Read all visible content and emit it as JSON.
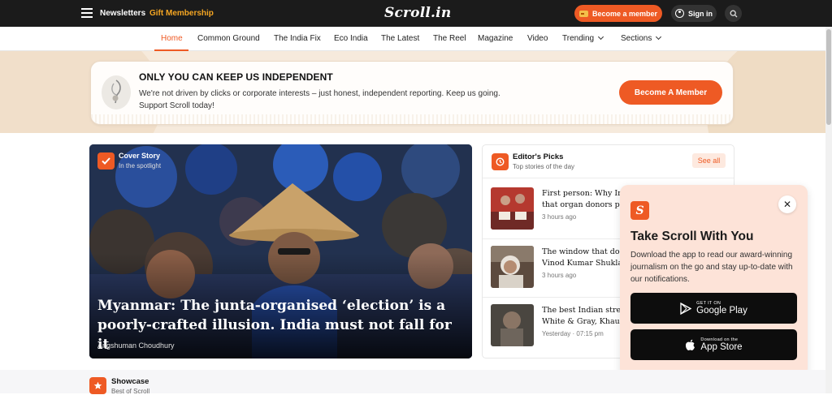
{
  "header": {
    "newsletters_label": "Newsletters",
    "gift_label": "Gift Membership",
    "logo_text": "Scroll.in",
    "become_member_label": "Become a member",
    "signin_label": "Sign in"
  },
  "nav": {
    "items": [
      {
        "label": "Home",
        "active": true
      },
      {
        "label": "Common Ground"
      },
      {
        "label": "The India Fix"
      },
      {
        "label": "Eco India"
      },
      {
        "label": "The Latest"
      },
      {
        "label": "The Reel"
      },
      {
        "label": "Magazine"
      },
      {
        "label": "Video"
      },
      {
        "label": "Trending",
        "dropdown": true
      },
      {
        "label": "Sections",
        "dropdown": true
      }
    ]
  },
  "banner": {
    "title": "ONLY YOU CAN KEEP US INDEPENDENT",
    "text": "We're not driven by clicks or corporate interests – just honest, independent reporting. Keep us going. Support Scroll today!",
    "button_label": "Become A Member"
  },
  "cover": {
    "kicker": "Cover Story",
    "sub": "In the spotlight",
    "headline": "Myanmar: The junta-organised ‘election’ is a poorly-crafted illusion. India must not fall for it",
    "author": "Angshuman Choudhury"
  },
  "picks": {
    "title": "Editor's Picks",
    "sub": "Top stories of the day",
    "see_all": "See all",
    "items": [
      {
        "title": "First person: Why Ind",
        "title2": "that organ donors pr",
        "time": "3 hours ago"
      },
      {
        "title": "The window that doe",
        "title2": "Vinod Kumar Shukla",
        "time": "3 hours ago"
      },
      {
        "title": "The best Indian strea",
        "title2": "White & Gray, Khauf",
        "time": "Yesterday · 07:15 pm"
      }
    ]
  },
  "promo": {
    "logo_letter": "S",
    "title": "Take Scroll With You",
    "text": "Download the app to read our award-winning journalism on the go and stay up-to-date with our notifications.",
    "google_small": "GET IT ON",
    "google_big": "Google Play",
    "apple_small": "Download on the",
    "apple_big": "App Store",
    "close_label": "✕"
  },
  "showcase": {
    "title": "Showcase",
    "sub": "Best of Scroll"
  },
  "colors": {
    "accent": "#ee5a24",
    "topbar": "#1b1b1b",
    "gift": "#f5a623"
  }
}
